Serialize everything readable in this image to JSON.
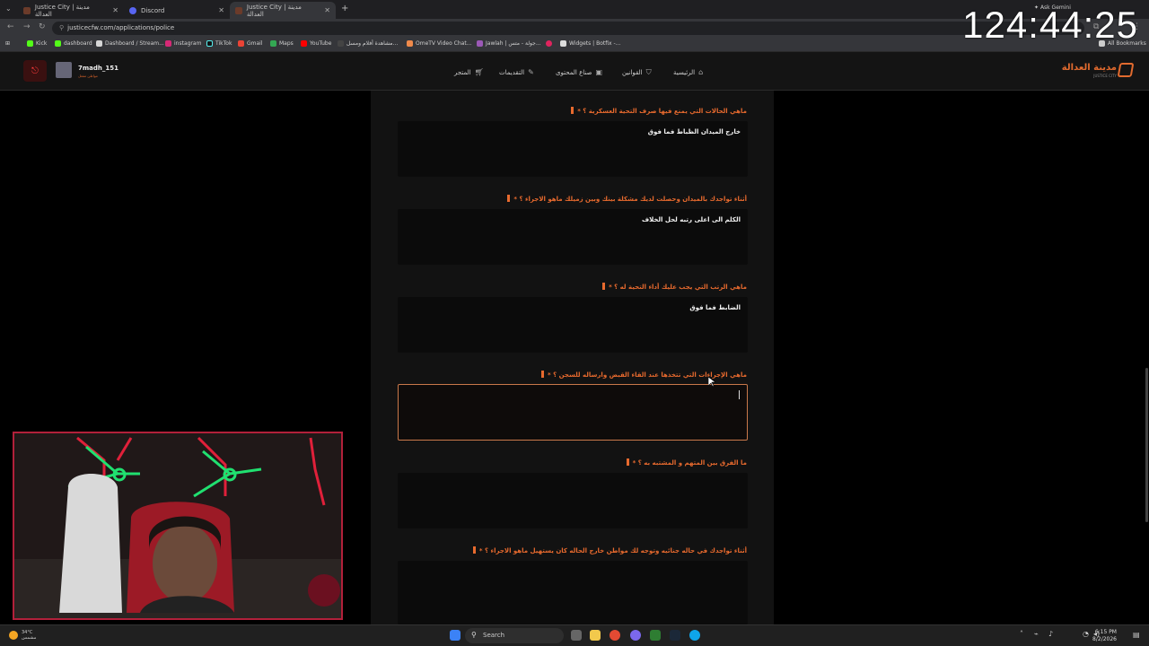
{
  "browser": {
    "tabs": [
      {
        "title": "Justice City | مدينة العدالة"
      },
      {
        "title": "Discord"
      },
      {
        "title": "Justice City | مدينة العدالة"
      }
    ],
    "url": "justicecfw.com/applications/police",
    "bookmarks": [
      "Kick",
      "dashboard",
      "Dashboard / Stream...",
      "instagram",
      "TikTok",
      "Gmail",
      "Maps",
      "YouTube",
      "مشاهدة أفلام ومسل...",
      "OmeTV Video Chat...",
      "Jawlah | جولة - متس...",
      "Widgets | Botfix -...",
      "All Bookmarks"
    ],
    "ask_gemini": "Ask Gemini"
  },
  "overlay": {
    "timer": "124:44:25"
  },
  "site": {
    "brand": {
      "name": "مدينة العدالة",
      "sub": "JUSTICE CITY"
    },
    "nav": [
      {
        "label": "الرئيسية"
      },
      {
        "label": "القوانين"
      },
      {
        "label": "صناع المحتوى"
      },
      {
        "label": "التقديمات"
      },
      {
        "label": "المتجر"
      }
    ],
    "user": {
      "name": "7madh_151",
      "role": "مواطن مفعل"
    }
  },
  "form": {
    "questions": [
      {
        "label": "ماهي الحالات التي يمنع فيها صرف التحية العسكرية ؟ *",
        "answer": "خارج الميدان الظباط فما فوق"
      },
      {
        "label": "أثناء تواجدك بالميدان وحصلت لديك مشكلة بينك وبين زميلك ماهو الاجراء ؟ *",
        "answer": "الكلم الى اعلى رتبه لحل الخلاف"
      },
      {
        "label": "ماهي الرتب التي يجب عليك أداء التحية له ؟ *",
        "answer": "الضابط فما فوق"
      },
      {
        "label": "ماهي الإجراءات التي تتخذها عند القاء القبض وارساله للسجن ؟ *",
        "answer": ""
      },
      {
        "label": "ما الفرق بين المتهم و المشتبه به ؟ *",
        "answer": ""
      },
      {
        "label": "أثناء تواجدك في حاله جنائيه وتوجه لك مواطن خارج الحاله كان يستهيل ماهو الاجراء ؟ *",
        "answer": ""
      }
    ]
  },
  "taskbar": {
    "search": "Search",
    "weather": {
      "temp": "34°C",
      "desc": "مشمس"
    },
    "time": "6:15 PM",
    "date": "8/2/2026"
  },
  "colors": {
    "accent": "#e86a2e",
    "page_bg": "#121212",
    "outer_bg": "#000000"
  }
}
